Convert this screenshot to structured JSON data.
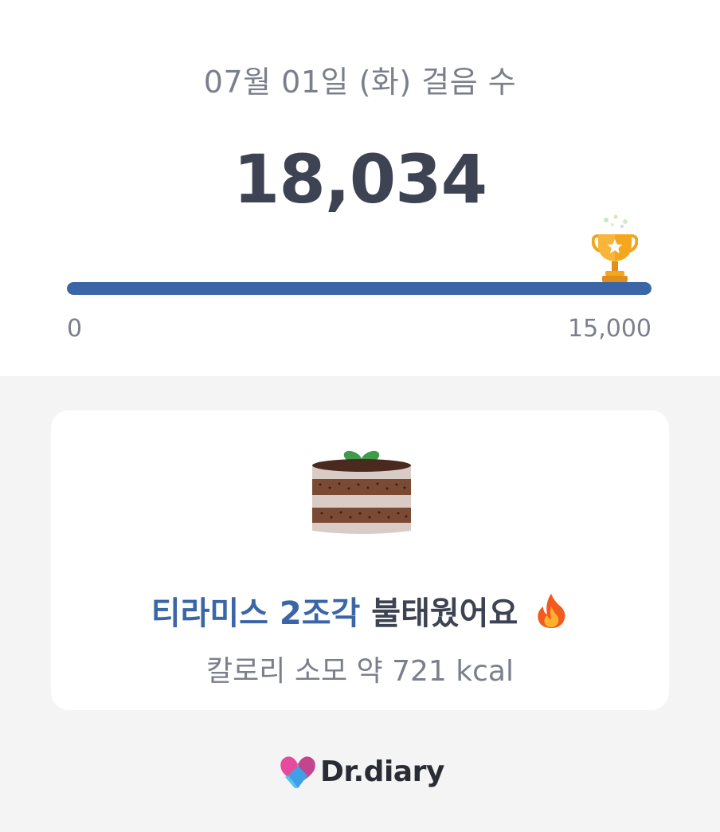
{
  "header": {
    "date_title": "07월 01일 (화) 걸음 수",
    "step_count": "18,034"
  },
  "progress": {
    "min_label": "0",
    "max_label": "15,000",
    "fraction_of_goal": 1.0,
    "goal_achieved_icon": "trophy-icon",
    "fill_color": "#3a66a8"
  },
  "card": {
    "food_icon": "tiramisu-cake-icon",
    "burn_food": "티라미스 2조각",
    "burn_suffix": "불태웠어요",
    "burn_emoji_icon": "fire-icon",
    "calorie_text": "칼로리 소모 약 721 kcal",
    "accent_color": "#3a66a8"
  },
  "footer": {
    "brand_name": "Dr.diary",
    "brand_logo_icon": "heart-logo-icon"
  }
}
